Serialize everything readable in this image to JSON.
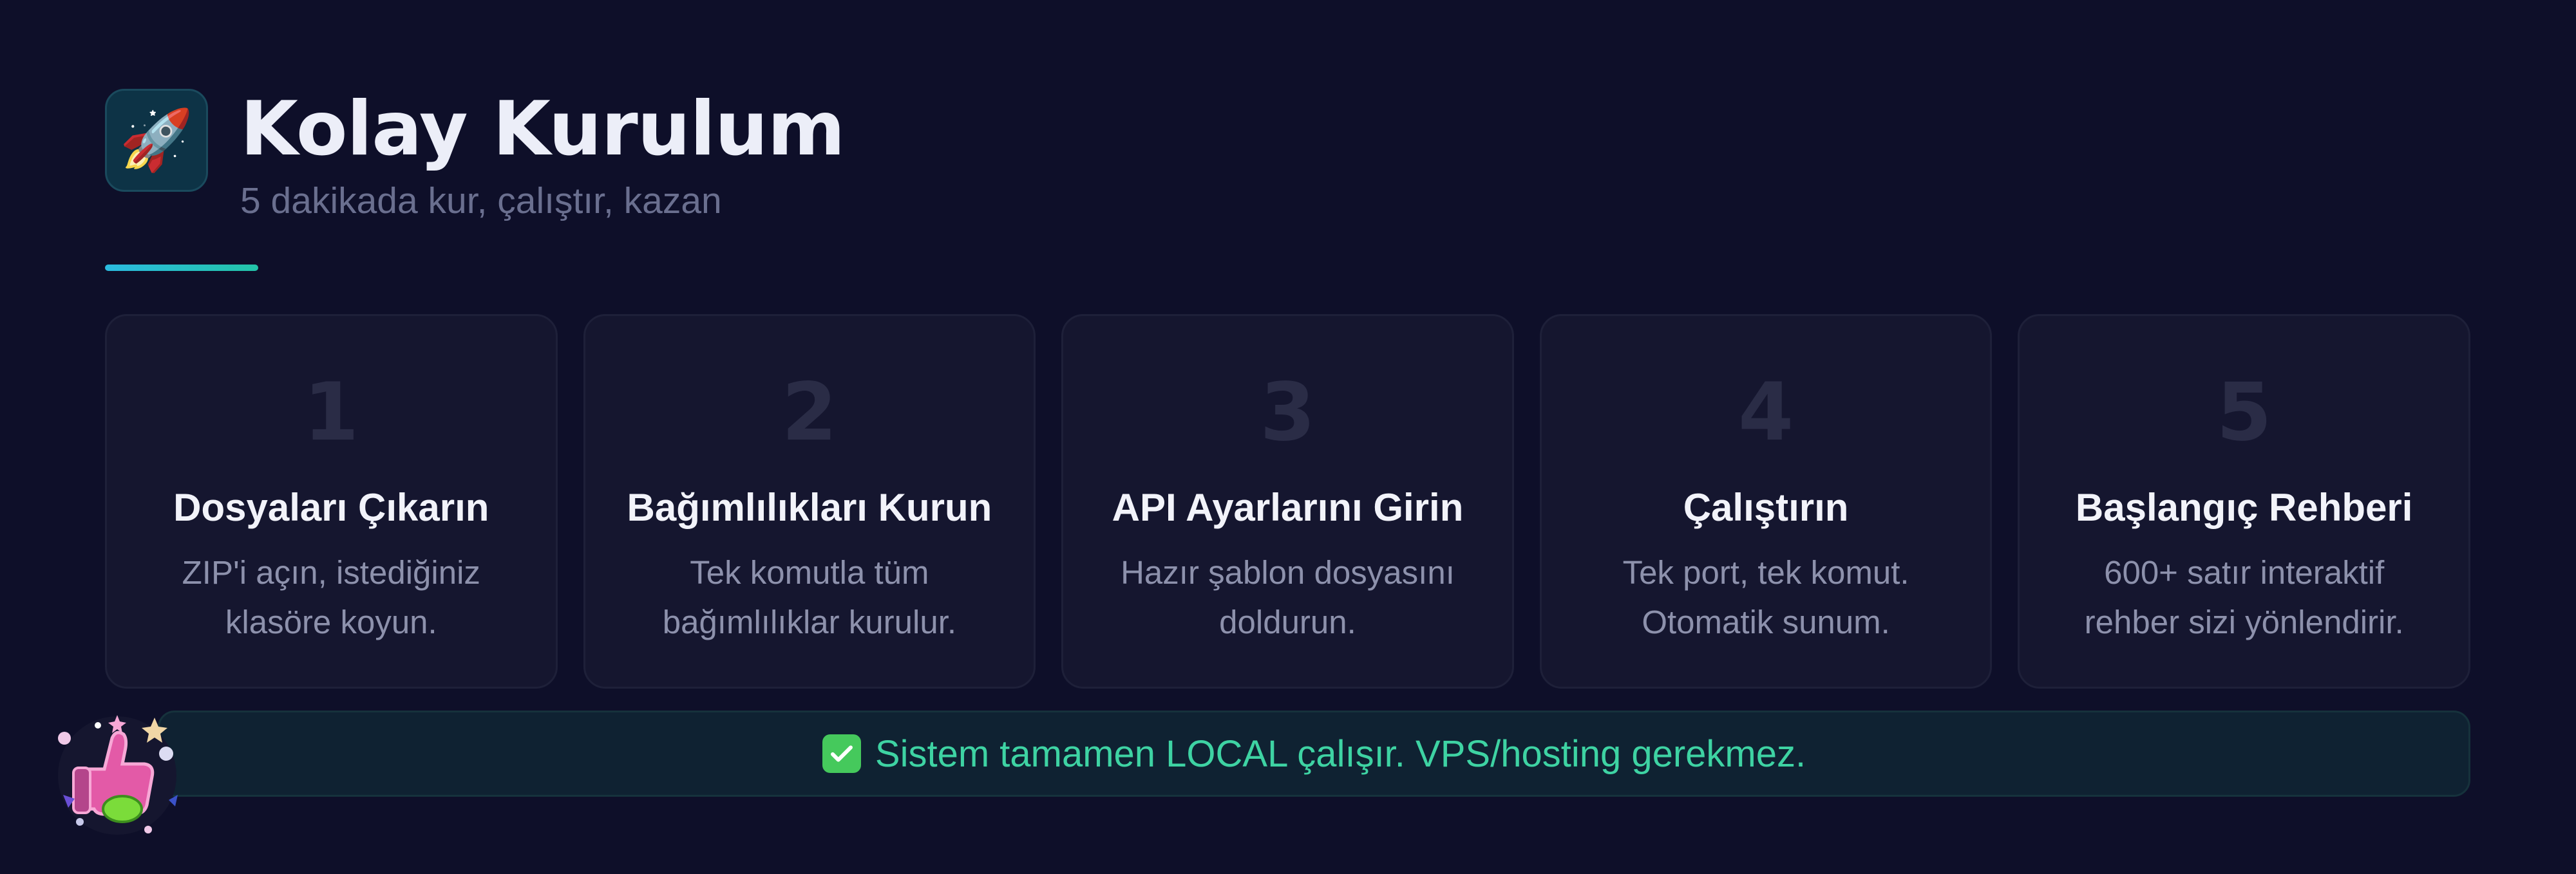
{
  "header": {
    "icon": "rocket-icon",
    "title": "Kolay Kurulum",
    "subtitle": "5 dakikada kur, çalıştır, kazan"
  },
  "steps": [
    {
      "number": "1",
      "title": "Dosyaları Çıkarın",
      "desc_line1": "ZIP'i açın, istediğiniz",
      "desc_line2": "klasöre koyun."
    },
    {
      "number": "2",
      "title": "Bağımlılıkları Kurun",
      "desc_line1": "Tek komutla tüm",
      "desc_line2": "bağımlılıklar kurulur."
    },
    {
      "number": "3",
      "title": "API Ayarlarını Girin",
      "desc_line1": "Hazır şablon dosyasını",
      "desc_line2": "doldurun."
    },
    {
      "number": "4",
      "title": "Çalıştırın",
      "desc_line1": "Tek port, tek komut.",
      "desc_line2": "Otomatik sunum."
    },
    {
      "number": "5",
      "title": "Başlangıç Rehberi",
      "desc_line1": "600+ satır interaktif",
      "desc_line2": "rehber sizi yönlendirir."
    }
  ],
  "notice": {
    "icon": "check-mark-icon",
    "text": "Sistem tamamen LOCAL çalışır. VPS/hosting gerekmez."
  },
  "sticker": {
    "icon": "thumbs-up-sticker-icon"
  },
  "colors": {
    "background": "#0e0f29",
    "card": "#15162f",
    "accent_start": "#2bbbe0",
    "accent_end": "#23c4a8",
    "notice_text": "#3ed3a3",
    "check_green": "#45c95c"
  }
}
